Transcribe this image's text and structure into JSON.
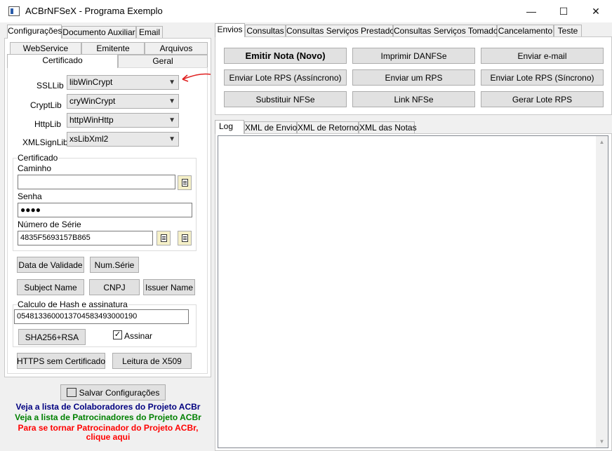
{
  "window": {
    "title": "ACBrNFSeX - Programa Exemplo",
    "minimize": "—",
    "maximize": "☐",
    "close": "✕"
  },
  "left": {
    "tabs": [
      "Configurações",
      "Documento Auxiliar",
      "Email"
    ],
    "subtabs_row1": [
      "WebService",
      "Emitente",
      "Arquivos"
    ],
    "subtabs_row2": [
      "Certificado",
      "Geral"
    ],
    "ssllib": {
      "label": "SSLLib",
      "value": "libWinCrypt"
    },
    "cryptlib": {
      "label": "CryptLib",
      "value": "cryWinCrypt"
    },
    "httplib": {
      "label": "HttpLib",
      "value": "httpWinHttp"
    },
    "xmlsignlib": {
      "label": "XMLSignLib",
      "value": "xsLibXml2"
    },
    "cert_group": {
      "title": "Certificado",
      "path_label": "Caminho",
      "path_value": "",
      "password_label": "Senha",
      "password_value": "●●●●",
      "serial_label": "Número de Série",
      "serial_value": "4835F5693157B865"
    },
    "buttons": {
      "data_validade": "Data de Validade",
      "num_serie": "Num.Série",
      "subject_name": "Subject Name",
      "cnpj": "CNPJ",
      "issuer_name": "Issuer Name",
      "sha256": "SHA256+RSA",
      "https": "HTTPS sem Certificado",
      "x509": "Leitura de X509",
      "save": "Salvar Configurações"
    },
    "hash_group": {
      "title": "Calculo de Hash e assinatura",
      "value": "05481336000137045834930001​90",
      "assinar_label": "Assinar",
      "assinar_checked": true
    },
    "links": {
      "colaboradores": "Veja a lista de Colaboradores do Projeto ACBr",
      "patrocinadores": "Veja a lista de Patrocinadores do Projeto ACBr",
      "patrocinador1": "Para se tornar Patrocinador do Projeto ACBr,",
      "patrocinador2": "clique aqui"
    },
    "colors": {
      "blue": "#000080",
      "green": "#008000",
      "red": "#ff0000",
      "annotation": "#e02020"
    }
  },
  "right": {
    "tabs": [
      "Envios",
      "Consultas",
      "Consultas Serviços Prestados",
      "Consultas Serviços Tomados",
      "Cancelamento",
      "Teste"
    ],
    "buttons": [
      [
        "Emitir Nota (Novo)",
        "Imprimir DANFSe",
        "Enviar e-mail"
      ],
      [
        "Enviar Lote RPS (Assíncrono)",
        "Enviar um RPS",
        "Enviar Lote RPS (Síncrono)"
      ],
      [
        "Substituir NFSe",
        "Link NFSe",
        "Gerar Lote RPS"
      ]
    ],
    "log_tabs": [
      "Log",
      "XML de Envio",
      "XML de Retorno",
      "XML das Notas"
    ]
  }
}
